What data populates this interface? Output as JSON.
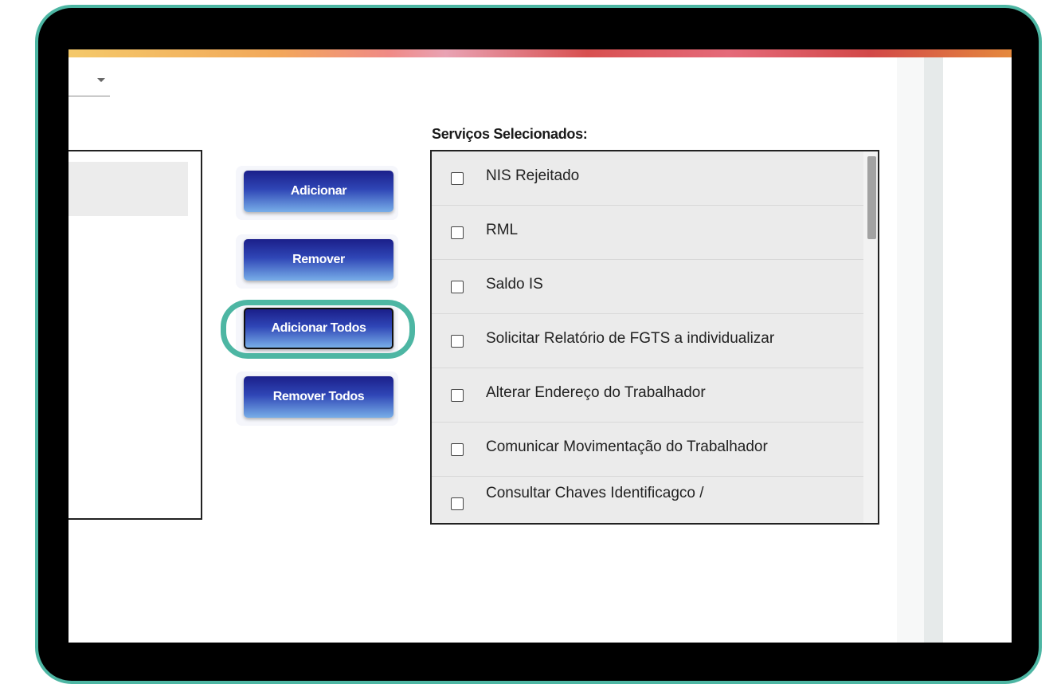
{
  "frame": {
    "accent_color": "#4db6a3"
  },
  "available": {
    "selected_value": ""
  },
  "actions": {
    "add_label": "Adicionar",
    "remove_label": "Remover",
    "add_all_label": "Adicionar Todos",
    "remove_all_label": "Remover Todos",
    "highlighted": "Adicionar Todos"
  },
  "selected": {
    "title": "Serviços Selecionados:",
    "items": [
      {
        "label": "NIS Rejeitado",
        "checked": false
      },
      {
        "label": "RML",
        "checked": false
      },
      {
        "label": "Saldo IS",
        "checked": false
      },
      {
        "label": "Solicitar Relatório de FGTS a individualizar",
        "checked": false
      },
      {
        "label": "Alterar Endereço do Trabalhador",
        "checked": false
      },
      {
        "label": "Comunicar Movimentação do Trabalhador",
        "checked": false
      },
      {
        "label": "Consultar Chaves Identificagco /",
        "checked": false
      }
    ]
  },
  "colors": {
    "button_gradient_top": "#1b1f8a",
    "button_gradient_bottom": "#78aee8",
    "button_text": "#ffffff"
  }
}
